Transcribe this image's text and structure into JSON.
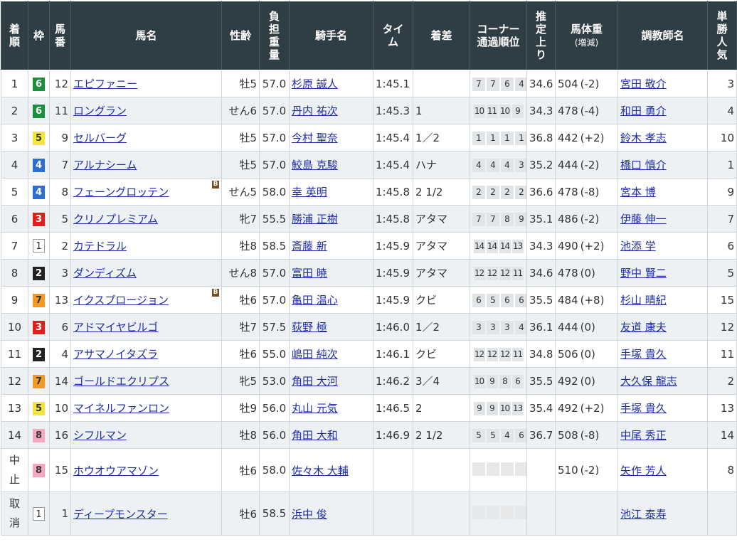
{
  "headers": {
    "rank": [
      "着",
      "順"
    ],
    "waku": "枠",
    "number": [
      "馬",
      "番"
    ],
    "horse": "馬名",
    "sex_age": "性齢",
    "weight": [
      "負",
      "担",
      "重",
      "量"
    ],
    "jockey": "騎手名",
    "time": [
      "タイ",
      "ム"
    ],
    "margin": "着差",
    "corner": [
      "コーナー",
      "通過順位"
    ],
    "last3f": [
      "推",
      "定",
      "上",
      "り"
    ],
    "body_weight": "馬体重",
    "body_weight_sub": "(増減)",
    "trainer": "調教師名",
    "popularity": [
      "単",
      "勝",
      "人",
      "気"
    ]
  },
  "blinker_label": "B",
  "waku_colors": {
    "1": "#ffffff",
    "2": "#222222",
    "3": "#e02020",
    "4": "#2b6fd0",
    "5": "#f3e53a",
    "6": "#1c8f3a",
    "7": "#f39a26",
    "8": "#f5a7c1"
  },
  "rows": [
    {
      "rank": "1",
      "waku": "6",
      "number": "12",
      "horse": "エピファニー",
      "blinker": false,
      "sex_age": "牡5",
      "weight": "57.0",
      "jockey": "杉原 誠人",
      "time": "1:45.1",
      "margin": "",
      "corners": [
        "7",
        "7",
        "6",
        "4"
      ],
      "last3f": "34.6",
      "body_weight": "504",
      "body_weight_diff": "(-2)",
      "trainer": "宮田 敬介",
      "popularity": "3"
    },
    {
      "rank": "2",
      "waku": "6",
      "number": "11",
      "horse": "ロングラン",
      "blinker": false,
      "sex_age": "せん6",
      "weight": "57.0",
      "jockey": "丹内 祐次",
      "time": "1:45.3",
      "margin": "1",
      "corners": [
        "10",
        "11",
        "10",
        "9"
      ],
      "last3f": "34.3",
      "body_weight": "478",
      "body_weight_diff": "(-4)",
      "trainer": "和田 勇介",
      "popularity": "4"
    },
    {
      "rank": "3",
      "waku": "5",
      "number": "9",
      "horse": "セルバーグ",
      "blinker": false,
      "sex_age": "牡5",
      "weight": "57.0",
      "jockey": "今村 聖奈",
      "time": "1:45.4",
      "margin": "1／2",
      "corners": [
        "1",
        "1",
        "1",
        "1"
      ],
      "last3f": "36.8",
      "body_weight": "442",
      "body_weight_diff": "(+2)",
      "trainer": "鈴木 孝志",
      "popularity": "10"
    },
    {
      "rank": "4",
      "waku": "4",
      "number": "7",
      "horse": "アルナシーム",
      "blinker": false,
      "sex_age": "牡5",
      "weight": "57.0",
      "jockey": "鮫島 克駿",
      "time": "1:45.4",
      "margin": "ハナ",
      "corners": [
        "4",
        "4",
        "4",
        "3"
      ],
      "last3f": "35.2",
      "body_weight": "444",
      "body_weight_diff": "(-2)",
      "trainer": "橋口 慎介",
      "popularity": "1"
    },
    {
      "rank": "5",
      "waku": "4",
      "number": "8",
      "horse": "フェーングロッテン",
      "blinker": true,
      "sex_age": "せん5",
      "weight": "58.0",
      "jockey": "幸 英明",
      "time": "1:45.8",
      "margin": "2 1/2",
      "corners": [
        "2",
        "2",
        "2",
        "2"
      ],
      "last3f": "36.6",
      "body_weight": "478",
      "body_weight_diff": "(-8)",
      "trainer": "宮本 博",
      "popularity": "9"
    },
    {
      "rank": "6",
      "waku": "3",
      "number": "5",
      "horse": "クリノプレミアム",
      "blinker": false,
      "sex_age": "牝7",
      "weight": "55.5",
      "jockey": "勝浦 正樹",
      "time": "1:45.8",
      "margin": "アタマ",
      "corners": [
        "7",
        "7",
        "8",
        "9"
      ],
      "last3f": "35.1",
      "body_weight": "486",
      "body_weight_diff": "(-2)",
      "trainer": "伊藤 伸一",
      "popularity": "7"
    },
    {
      "rank": "7",
      "waku": "1",
      "number": "2",
      "horse": "カテドラル",
      "blinker": false,
      "sex_age": "牡8",
      "weight": "58.5",
      "jockey": "斎藤 新",
      "time": "1:45.9",
      "margin": "アタマ",
      "corners": [
        "14",
        "14",
        "14",
        "13"
      ],
      "last3f": "34.3",
      "body_weight": "490",
      "body_weight_diff": "(+2)",
      "trainer": "池添 学",
      "popularity": "6"
    },
    {
      "rank": "8",
      "waku": "2",
      "number": "3",
      "horse": "ダンディズム",
      "blinker": false,
      "sex_age": "せん8",
      "weight": "57.0",
      "jockey": "富田 暁",
      "time": "1:45.9",
      "margin": "アタマ",
      "corners": [
        "12",
        "12",
        "12",
        "11"
      ],
      "last3f": "34.6",
      "body_weight": "478",
      "body_weight_diff": "(0)",
      "trainer": "野中 賢二",
      "popularity": "5"
    },
    {
      "rank": "9",
      "waku": "7",
      "number": "13",
      "horse": "イクスプロージョン",
      "blinker": true,
      "sex_age": "牡6",
      "weight": "57.0",
      "jockey": "亀田 温心",
      "time": "1:45.9",
      "margin": "クビ",
      "corners": [
        "6",
        "5",
        "6",
        "6"
      ],
      "last3f": "35.5",
      "body_weight": "484",
      "body_weight_diff": "(+8)",
      "trainer": "杉山 晴紀",
      "popularity": "15"
    },
    {
      "rank": "10",
      "waku": "3",
      "number": "6",
      "horse": "アドマイヤビルゴ",
      "blinker": false,
      "sex_age": "牡7",
      "weight": "57.5",
      "jockey": "荻野 極",
      "time": "1:46.0",
      "margin": "1／2",
      "corners": [
        "3",
        "3",
        "3",
        "4"
      ],
      "last3f": "36.1",
      "body_weight": "444",
      "body_weight_diff": "(0)",
      "trainer": "友道 康夫",
      "popularity": "12"
    },
    {
      "rank": "11",
      "waku": "2",
      "number": "4",
      "horse": "アサマノイタズラ",
      "blinker": false,
      "sex_age": "牡6",
      "weight": "55.0",
      "jockey": "嶋田 純次",
      "time": "1:46.1",
      "margin": "クビ",
      "corners": [
        "12",
        "12",
        "12",
        "11"
      ],
      "last3f": "34.8",
      "body_weight": "506",
      "body_weight_diff": "(0)",
      "trainer": "手塚 貴久",
      "popularity": "11"
    },
    {
      "rank": "12",
      "waku": "7",
      "number": "14",
      "horse": "ゴールドエクリプス",
      "blinker": false,
      "sex_age": "牝5",
      "weight": "53.0",
      "jockey": "角田 大河",
      "time": "1:46.2",
      "margin": "3／4",
      "corners": [
        "10",
        "9",
        "8",
        "6"
      ],
      "last3f": "35.5",
      "body_weight": "492",
      "body_weight_diff": "(0)",
      "trainer": "大久保 龍志",
      "popularity": "2"
    },
    {
      "rank": "13",
      "waku": "5",
      "number": "10",
      "horse": "マイネルファンロン",
      "blinker": false,
      "sex_age": "牡9",
      "weight": "56.0",
      "jockey": "丸山 元気",
      "time": "1:46.5",
      "margin": "2",
      "corners": [
        "9",
        "9",
        "10",
        "13"
      ],
      "last3f": "35.4",
      "body_weight": "492",
      "body_weight_diff": "(+2)",
      "trainer": "手塚 貴久",
      "popularity": "13"
    },
    {
      "rank": "14",
      "waku": "8",
      "number": "16",
      "horse": "シフルマン",
      "blinker": false,
      "sex_age": "牡8",
      "weight": "56.0",
      "jockey": "角田 大和",
      "time": "1:46.9",
      "margin": "2 1/2",
      "corners": [
        "5",
        "5",
        "4",
        "6"
      ],
      "last3f": "36.7",
      "body_weight": "508",
      "body_weight_diff": "(-8)",
      "trainer": "中尾 秀正",
      "popularity": "14"
    },
    {
      "rank": "中止",
      "waku": "8",
      "number": "15",
      "horse": "ホウオウアマゾン",
      "blinker": false,
      "sex_age": "牡6",
      "weight": "58.0",
      "jockey": "佐々木 大輔",
      "time": "",
      "margin": "",
      "corners": [
        "",
        "",
        "",
        ""
      ],
      "last3f": "",
      "body_weight": "510",
      "body_weight_diff": "(-2)",
      "trainer": "矢作 芳人",
      "popularity": "8"
    },
    {
      "rank": "取消",
      "waku": "1",
      "number": "1",
      "horse": "ディープモンスター",
      "blinker": false,
      "sex_age": "牡6",
      "weight": "58.5",
      "jockey": "浜中 俊",
      "time": "",
      "margin": "",
      "corners": [
        "",
        "",
        "",
        ""
      ],
      "last3f": "",
      "body_weight": "",
      "body_weight_diff": "",
      "trainer": "池江 泰寿",
      "popularity": ""
    }
  ]
}
